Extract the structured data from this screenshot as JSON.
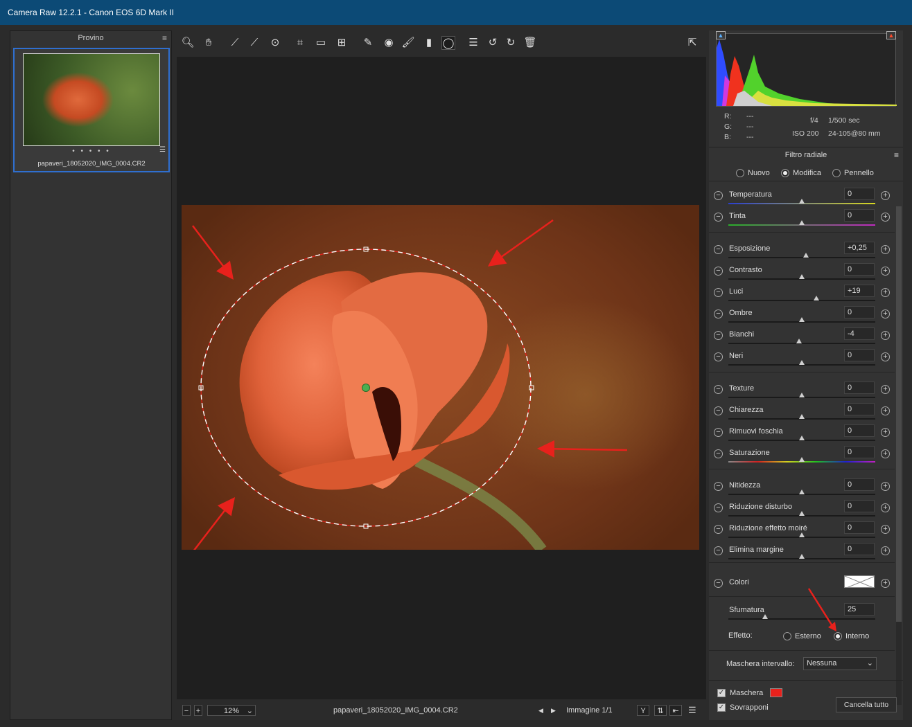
{
  "window": {
    "title": "Camera Raw 12.2.1  -  Canon EOS 6D Mark II"
  },
  "filmstrip": {
    "title": "Provino",
    "dots": "• • • • •",
    "thumbnail_name": "papaveri_18052020_IMG_0004.CR2"
  },
  "info": {
    "r_label": "R:",
    "g_label": "G:",
    "b_label": "B:",
    "r": "---",
    "g": "---",
    "b": "---",
    "aperture": "f/4",
    "shutter": "1/500 sec",
    "iso": "ISO 200",
    "lens": "24-105@80 mm"
  },
  "panel": {
    "title": "Filtro radiale",
    "modes": {
      "new": "Nuovo",
      "edit": "Modifica",
      "brush": "Pennello"
    },
    "sliders": [
      {
        "label": "Temperatura",
        "value": "0",
        "pos": 0.5
      },
      {
        "label": "Tinta",
        "value": "0",
        "pos": 0.5
      },
      {
        "label": "Esposizione",
        "value": "+0,25",
        "pos": 0.53
      },
      {
        "label": "Contrasto",
        "value": "0",
        "pos": 0.5
      },
      {
        "label": "Luci",
        "value": "+19",
        "pos": 0.6
      },
      {
        "label": "Ombre",
        "value": "0",
        "pos": 0.5
      },
      {
        "label": "Bianchi",
        "value": "-4",
        "pos": 0.48
      },
      {
        "label": "Neri",
        "value": "0",
        "pos": 0.5
      },
      {
        "label": "Texture",
        "value": "0",
        "pos": 0.5
      },
      {
        "label": "Chiarezza",
        "value": "0",
        "pos": 0.5
      },
      {
        "label": "Rimuovi foschia",
        "value": "0",
        "pos": 0.5
      },
      {
        "label": "Saturazione",
        "value": "0",
        "pos": 0.5
      },
      {
        "label": "Nitidezza",
        "value": "0",
        "pos": 0.5
      },
      {
        "label": "Riduzione disturbo",
        "value": "0",
        "pos": 0.5
      },
      {
        "label": "Riduzione effetto moiré",
        "value": "0",
        "pos": 0.5
      },
      {
        "label": "Elimina margine",
        "value": "0",
        "pos": 0.5
      }
    ],
    "colori_label": "Colori",
    "feather_label": "Sfumatura",
    "feather_value": "25",
    "feather_pos": 0.25,
    "effect_label": "Effetto:",
    "effect_outside": "Esterno",
    "effect_inside": "Interno",
    "range_mask_label": "Maschera intervallo:",
    "range_mask_value": "Nessuna",
    "mask_label": "Maschera",
    "mask_color": "#e8211c",
    "overlay_label": "Sovrapponi",
    "clear_all": "Cancella tutto"
  },
  "bottombar": {
    "zoom": "12%",
    "filename": "papaveri_18052020_IMG_0004.CR2",
    "image_counter": "Immagine 1/1",
    "y_toggle": "Y"
  },
  "colors": {
    "accent": "#2f6fd0",
    "title_bar": "#0c4a76",
    "annotation": "#e8211c"
  }
}
